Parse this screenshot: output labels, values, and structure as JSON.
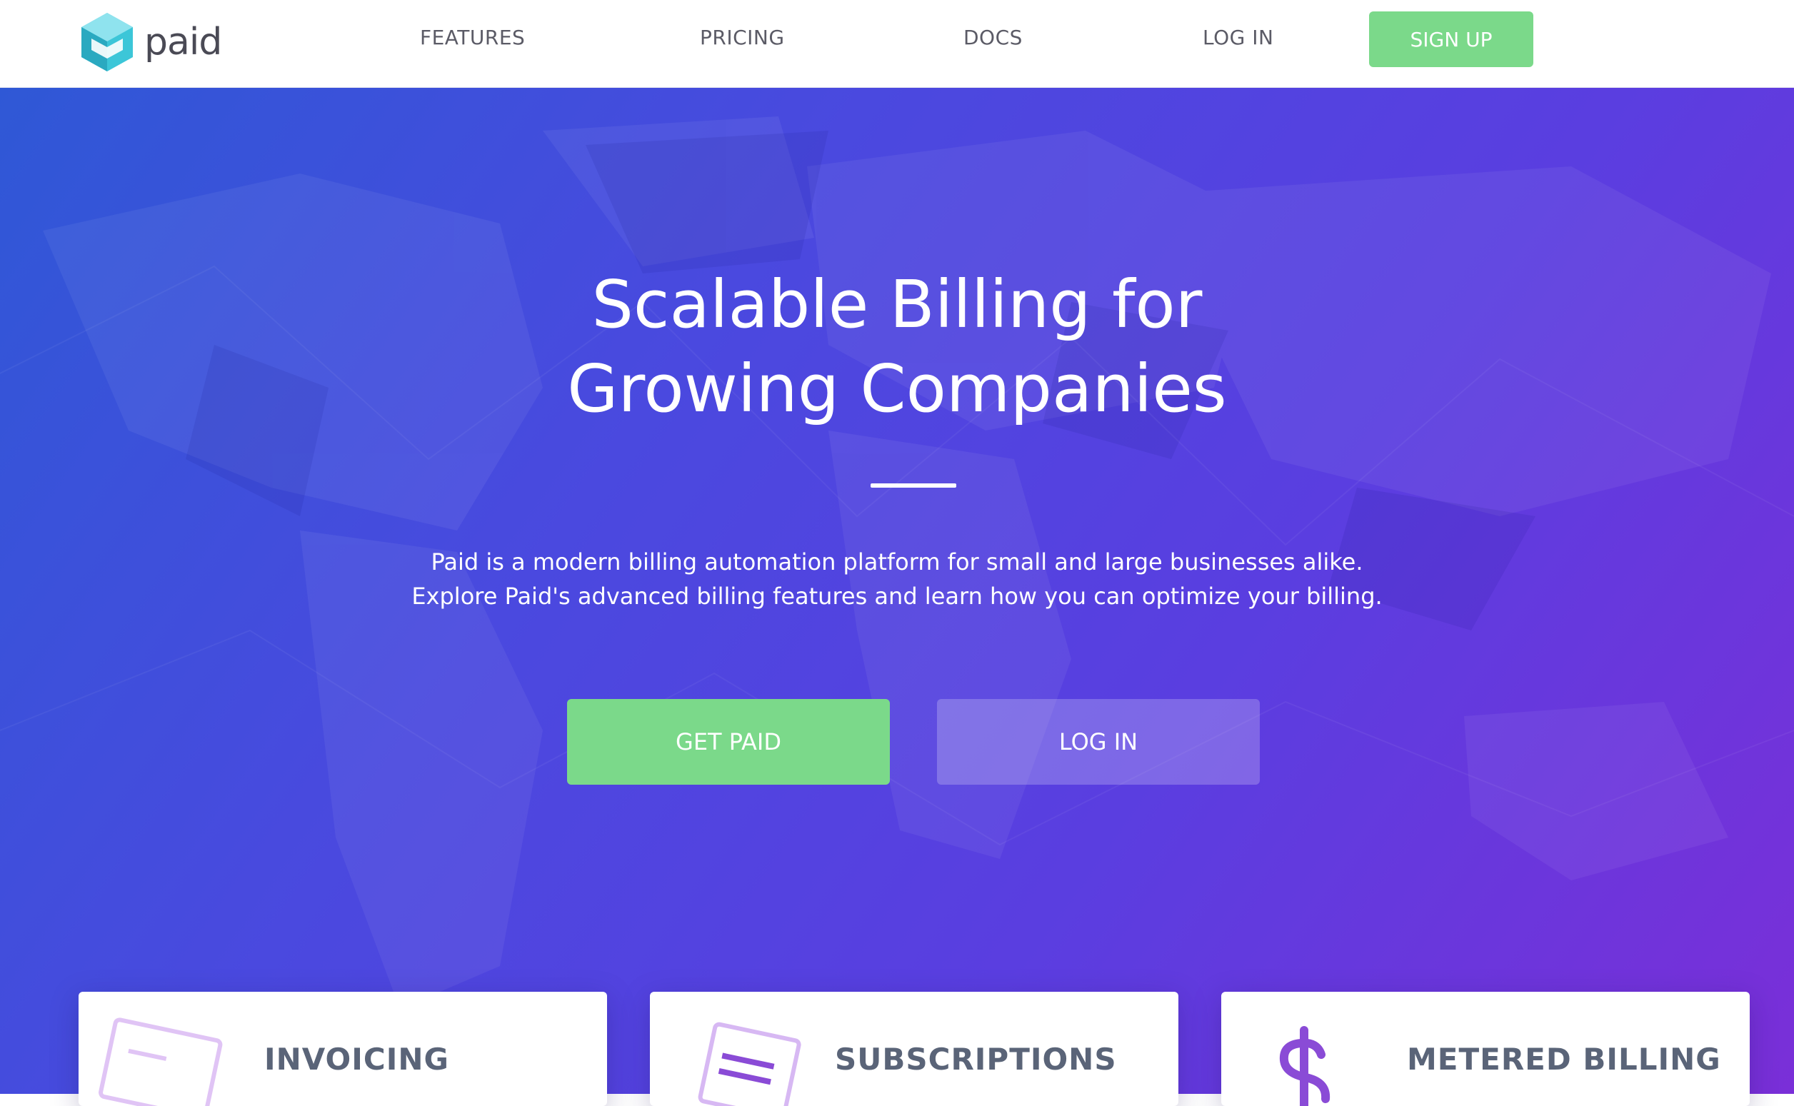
{
  "brand": {
    "name": "paid"
  },
  "nav": {
    "features": "FEATURES",
    "pricing": "PRICING",
    "docs": "DOCS",
    "login": "LOG IN",
    "signup": "SIGN UP"
  },
  "hero": {
    "title_line1": "Scalable Billing for",
    "title_line2": "Growing Companies",
    "desc_line1": "Paid is a modern billing automation platform for small and large businesses alike.",
    "desc_line2": "Explore Paid's advanced billing features and learn how you can optimize your billing.",
    "cta_primary": "GET PAID",
    "cta_secondary": "LOG IN"
  },
  "features": [
    {
      "title": "INVOICING",
      "icon": "invoice-icon"
    },
    {
      "title": "SUBSCRIPTIONS",
      "icon": "subscription-icon"
    },
    {
      "title": "METERED BILLING",
      "icon": "dollar-icon"
    }
  ],
  "colors": {
    "accent_green": "#7bd98a",
    "gradient_start": "#2f58d6",
    "gradient_end": "#7a2fd8",
    "logo_teal": "#3cc6d8",
    "icon_purple": "#8a4bd6"
  }
}
